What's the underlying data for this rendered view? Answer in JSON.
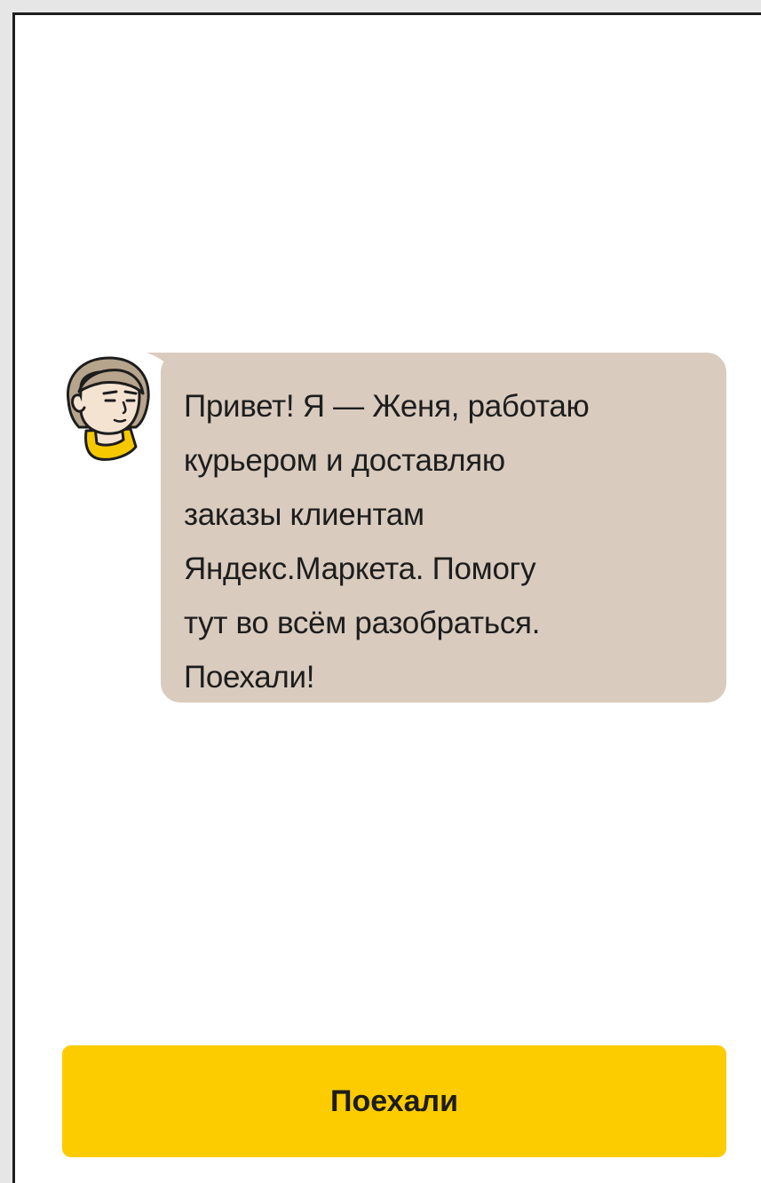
{
  "onboarding": {
    "message": "Привет! Я — Женя, работаю\nкурьером и доставляю\nзаказы клиентам\nЯндекс.Маркета. Помогу\nтут во всём разобраться.\nПоехали!",
    "button_label": "Поехали"
  },
  "colors": {
    "bubble": "#d9cbbe",
    "button": "#fccc00",
    "text": "#1d1d1d"
  },
  "icons": {
    "avatar": "courier-avatar-icon"
  }
}
